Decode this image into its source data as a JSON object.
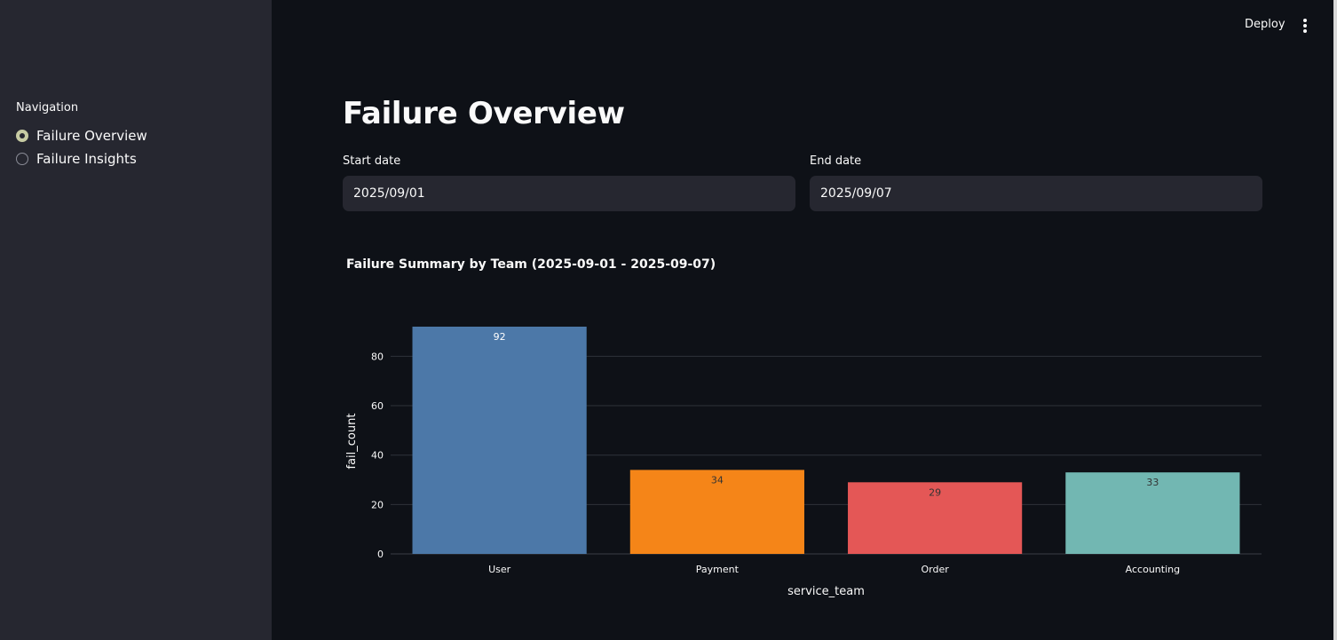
{
  "sidebar": {
    "nav_label": "Navigation",
    "options": [
      {
        "label": "Failure Overview",
        "selected": true
      },
      {
        "label": "Failure Insights",
        "selected": false
      }
    ]
  },
  "header": {
    "deploy_label": "Deploy",
    "menu_icon": "vertical-ellipsis-icon"
  },
  "main": {
    "title": "Failure Overview",
    "start_date": {
      "label": "Start date",
      "value": "2025/09/01"
    },
    "end_date": {
      "label": "End date",
      "value": "2025/09/07"
    }
  },
  "colors": {
    "accent": "#c7cba3",
    "sidebar_bg": "#262730",
    "main_bg": "#0e1117",
    "input_bg": "#262730"
  },
  "chart_data": {
    "type": "bar",
    "title": "Failure Summary by Team (2025-09-01 - 2025-09-07)",
    "xlabel": "service_team",
    "ylabel": "fail_count",
    "categories": [
      "User",
      "Payment",
      "Order",
      "Accounting"
    ],
    "values": [
      92,
      34,
      29,
      33
    ],
    "colors": [
      "#4c78a8",
      "#f58518",
      "#e45756",
      "#72b7b2"
    ],
    "label_colors": [
      "#ffffff",
      "#333333",
      "#333333",
      "#333333"
    ],
    "yticks": [
      0,
      20,
      40,
      60,
      80
    ],
    "ylim": [
      0,
      92
    ],
    "grid": true,
    "legend": false
  }
}
